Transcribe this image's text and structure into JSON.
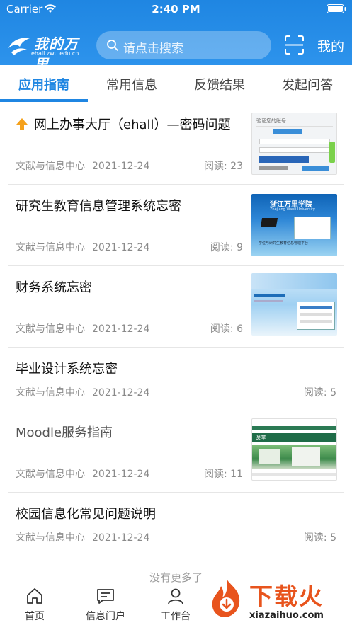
{
  "status": {
    "carrier": "Carrier",
    "time": "2:40 PM"
  },
  "header": {
    "logo_text": "我的万里",
    "logo_url": "ehall.zwu.edu.cn",
    "search_placeholder": "请点击搜索",
    "mine_label": "我的",
    "accent_color": "#1f86e2"
  },
  "tabs": [
    {
      "label": "应用指南",
      "active": true
    },
    {
      "label": "常用信息",
      "active": false
    },
    {
      "label": "反馈结果",
      "active": false
    },
    {
      "label": "发起问答",
      "active": false
    }
  ],
  "articles": [
    {
      "title": "网上办事大厅（ehall）—密码问题",
      "pinned": true,
      "source": "文献与信息中心",
      "date": "2021-12-24",
      "reads": "阅读: 23",
      "has_thumb": true
    },
    {
      "title": "研究生教育信息管理系统忘密",
      "pinned": false,
      "source": "文献与信息中心",
      "date": "2021-12-24",
      "reads": "阅读: 9",
      "has_thumb": true
    },
    {
      "title": "财务系统忘密",
      "pinned": false,
      "source": "文献与信息中心",
      "date": "2021-12-24",
      "reads": "阅读: 6",
      "has_thumb": true
    },
    {
      "title": "毕业设计系统忘密",
      "pinned": false,
      "source": "文献与信息中心",
      "date": "2021-12-24",
      "reads": "阅读: 5",
      "has_thumb": false
    },
    {
      "title": "Moodle服务指南",
      "pinned": false,
      "source": "文献与信息中心",
      "date": "2021-12-24",
      "reads": "阅读: 11",
      "has_thumb": true
    },
    {
      "title": "校园信息化常见问题说明",
      "pinned": false,
      "source": "文献与信息中心",
      "date": "2021-12-24",
      "reads": "阅读: 5",
      "has_thumb": false
    }
  ],
  "thumbs": {
    "t1_title": "验证您的账号",
    "t2_title": "浙江万里学院",
    "t2_sub": "Zhejiang Wanli University",
    "t2_caption": "学位与研究生教育信息管理平台",
    "t5_title": "课堂"
  },
  "list_end": "没有更多了",
  "bottom_nav": [
    {
      "label": "首页",
      "icon": "home-icon"
    },
    {
      "label": "信息门户",
      "icon": "message-icon"
    },
    {
      "label": "工作台",
      "icon": "user-icon"
    }
  ],
  "watermark": {
    "text": "下载火",
    "url": "xiazaihuo.com"
  }
}
